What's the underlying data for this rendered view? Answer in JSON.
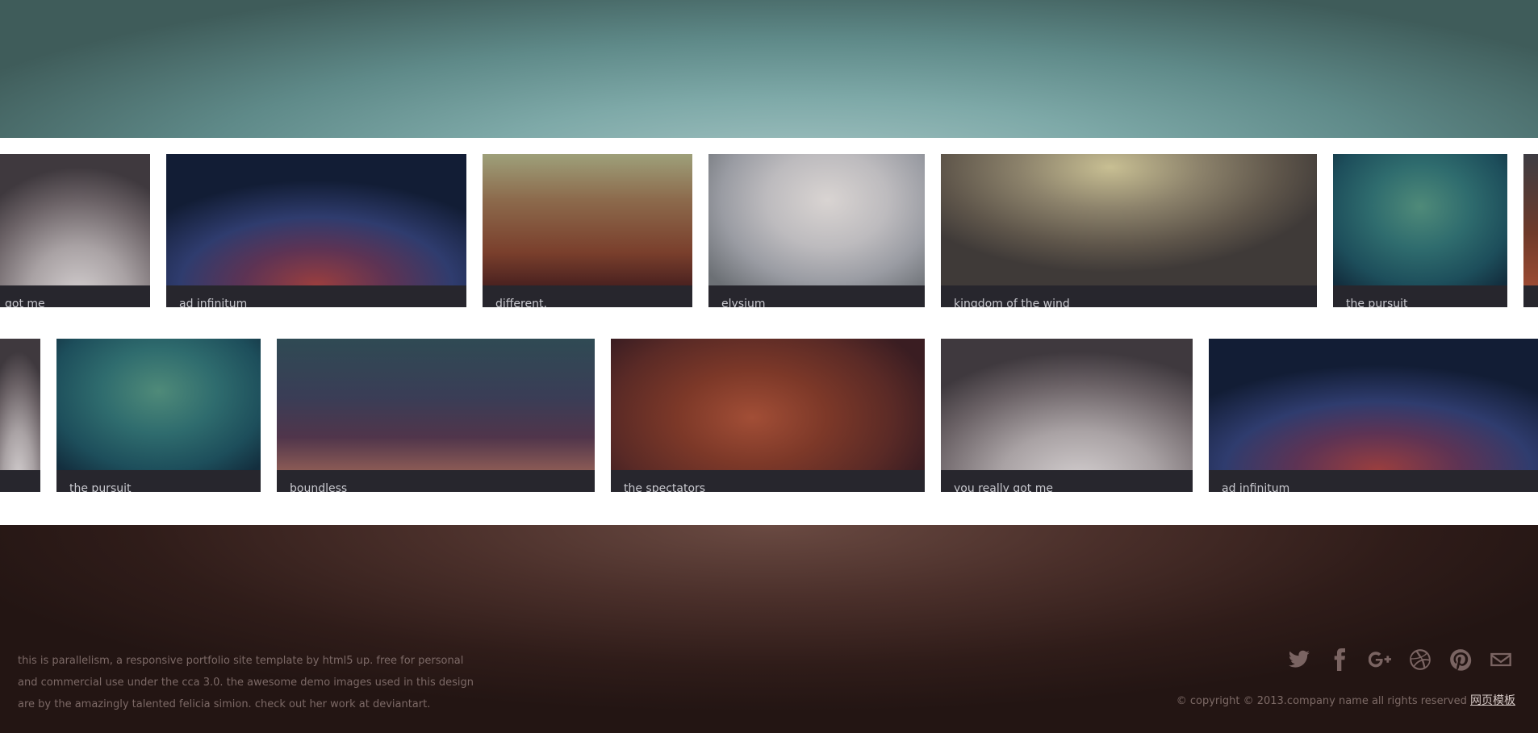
{
  "reel_1": [
    {
      "caption": "got me",
      "tone": "grey"
    },
    {
      "caption": "ad infinitum",
      "tone": "navy"
    },
    {
      "caption": "different.",
      "tone": "copper"
    },
    {
      "caption": "elysium",
      "tone": "silver"
    },
    {
      "caption": "kingdom of the wind",
      "tone": "khaki"
    },
    {
      "caption": "the pursuit",
      "tone": "teal"
    },
    {
      "caption": "",
      "tone": "rust"
    }
  ],
  "reel_2": [
    {
      "caption": "",
      "tone": "grey"
    },
    {
      "caption": "the pursuit",
      "tone": "teal"
    },
    {
      "caption": "boundless",
      "tone": "boundless"
    },
    {
      "caption": "the spectators",
      "tone": "spectators"
    },
    {
      "caption": "you really got me",
      "tone": "grey"
    },
    {
      "caption": "ad infinitum",
      "tone": "navy"
    }
  ],
  "footer": {
    "about_lines": [
      "this is parallelism, a responsive portfolio site template by html5 up. free for personal",
      "and commercial use under the cca 3.0. the awesome demo images used in this design",
      "are by the amazingly talented felicia simion. check out her work at deviantart."
    ],
    "social_icons": [
      "twitter-icon",
      "facebook-icon",
      "google-plus-icon",
      "dribbble-icon",
      "pinterest-icon",
      "envelope-icon"
    ],
    "copyright": "© copyright © 2013.company name all rights reserved",
    "copyright_link": "网页模板"
  },
  "colors": {
    "top_band": "#7ea9a8",
    "bottom_band": "#3a2420",
    "caption_bg": "#1b1a22",
    "footer_text": "#7c6966"
  }
}
